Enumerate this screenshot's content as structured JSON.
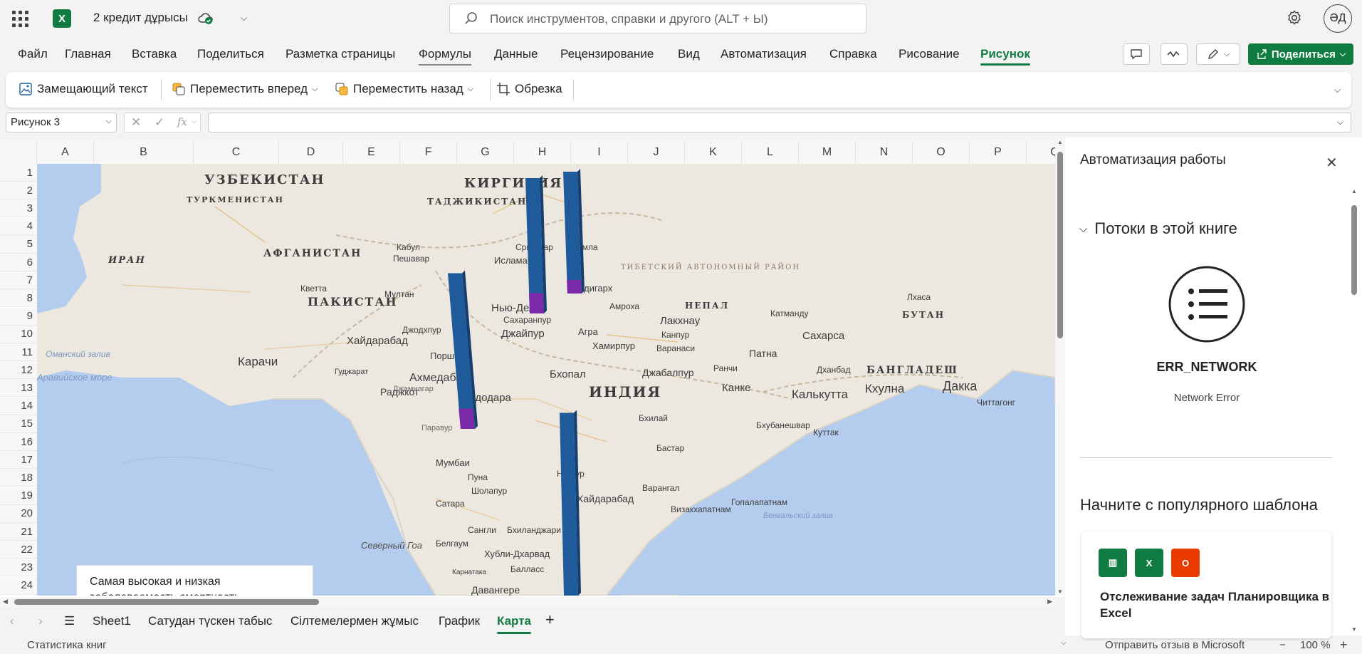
{
  "app": {
    "doc_title": "2 кредит дұрысы",
    "avatar_initials": "ӘД",
    "search_placeholder": "Поиск инструментов, справки и другого (ALT + Ы)",
    "brand_color": "#107c41"
  },
  "menu": {
    "tabs": [
      "Файл",
      "Главная",
      "Вставка",
      "Поделиться",
      "Разметка страницы",
      "Формулы",
      "Данные",
      "Рецензирование",
      "Вид",
      "Автоматизация",
      "Справка",
      "Рисование",
      "Рисунок"
    ],
    "active_tab": "Рисунок",
    "share_label": "Поделиться"
  },
  "ribbon": {
    "alt_text": "Замещающий текст",
    "bring_forward": "Переместить вперед",
    "send_backward": "Переместить назад",
    "crop": "Обрезка"
  },
  "formula_bar": {
    "name_box": "Рисунок 3",
    "fx": "fx",
    "formula": ""
  },
  "grid": {
    "columns": [
      "A",
      "B",
      "C",
      "D",
      "E",
      "F",
      "G",
      "H",
      "I",
      "J",
      "K",
      "L",
      "M",
      "N",
      "O",
      "P",
      "Q"
    ],
    "rows": [
      "1",
      "2",
      "3",
      "4",
      "5",
      "6",
      "7",
      "8",
      "9",
      "10",
      "11",
      "12",
      "13",
      "14",
      "15",
      "16",
      "17",
      "18",
      "19",
      "20",
      "21",
      "22",
      "23",
      "24"
    ]
  },
  "map": {
    "countries": [
      "УЗБЕКИСТАН",
      "КИРГИЗИЯ",
      "ТУРКМЕНИСТАН",
      "ТАДЖИКИСТАН",
      "АФГАНИСТАН",
      "ИРАН",
      "ПАКИСТАН",
      "НЕПАЛ",
      "БУТАН",
      "БАНГЛАДЕШ",
      "ИНДИЯ",
      "ТИБЕТСКИЙ АВТОНОМНЫЙ РАЙОН"
    ],
    "cities": [
      "Кабул",
      "Пешавар",
      "Исламабад",
      "Сринагар",
      "Шимла",
      "Чандигарх",
      "Кветта",
      "Мултан",
      "Нью-Дели",
      "Сахаранпур",
      "Амроха",
      "Катманду",
      "Лхаса",
      "Карачи",
      "Хайдарабад",
      "Джодхпур",
      "Джайпур",
      "Агра",
      "Лакхнау",
      "Канпур",
      "Сахарса",
      "Джамнагар",
      "Бхопал",
      "Вадодара",
      "Ахмедабад",
      "Раджкот",
      "Джабалпур",
      "Кхулна",
      "Дакка",
      "Калькутта",
      "Мумбаи",
      "Пуна",
      "Нагпур",
      "Хайдарабад",
      "Сатара",
      "Белгаум",
      "Хубли-Дхарвад",
      "Давангере",
      "Варангал",
      "Визакхапатнам",
      "Патна",
      "Ранчи",
      "Канке",
      "Читтагонг",
      "Поршина",
      "Дханбад",
      "Хамирпур",
      "Варанаси",
      "Куттак",
      "Гопалапатнам",
      "Сангли",
      "Бхиланджари",
      "Балласс",
      "Шолапур",
      "Бхилай",
      "Бастар",
      "Бхубанешвар",
      "Паравур"
    ],
    "waters": [
      "Оманский залив",
      "Аравийское море",
      "Бенгальский залив",
      "Северный Гоа",
      "Гуджарат",
      "Карнатака"
    ],
    "caption": "Самая высокая и низкая заболеваемость смертность",
    "bars": [
      {
        "location": "Нью-Дели",
        "value": 1.0,
        "low_value": 0.15
      },
      {
        "location": "Чандигарх",
        "value": 0.9,
        "low_value": 0.1
      },
      {
        "location": "Ахмедабад",
        "value": 1.15,
        "low_value": 0.15
      },
      {
        "location": "Хайдарабад",
        "value": 1.35,
        "low_value": 0.0
      }
    ]
  },
  "sheets": {
    "tabs": [
      "Sheet1",
      "Сатудан түскен табыс",
      "Сілтемелермен жұмыс",
      "График",
      "Карта"
    ],
    "active": "Карта"
  },
  "status": {
    "left": "Статистика книг",
    "feedback": "Отправить отзыв в Microsoft",
    "zoom": "100 %"
  },
  "pane": {
    "title": "Автоматизация работы",
    "section": "Потоки в этой книге",
    "error_title": "ERR_NETWORK",
    "error_subtitle": "Network Error",
    "templates_title": "Начните с популярного шаблона",
    "template_name": "Отслеживание задач Планировщика в Excel"
  }
}
